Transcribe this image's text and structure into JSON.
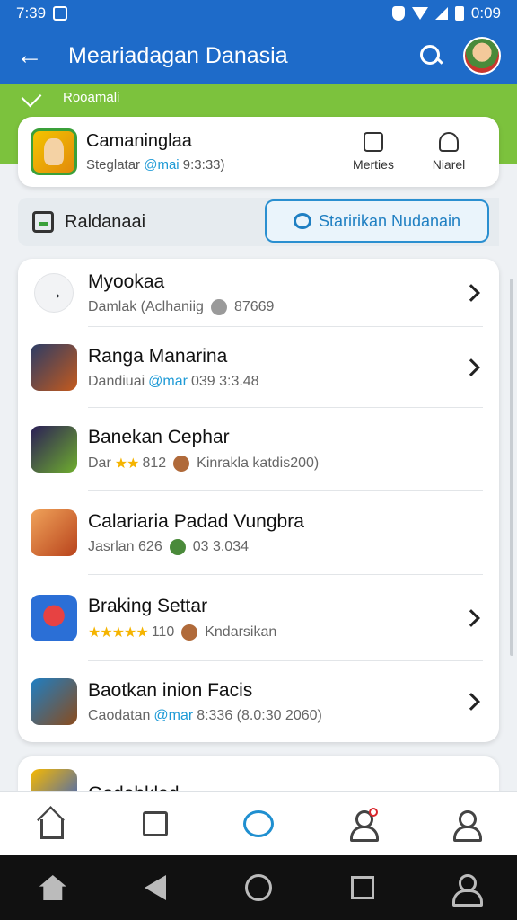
{
  "status_bar": {
    "time": "7:39",
    "battery": "0:09"
  },
  "app_bar": {
    "title": "Meariadagan Danasia",
    "back_icon": "back-arrow-icon",
    "search_icon": "search-icon"
  },
  "banner": {
    "label": "Rooamali"
  },
  "featured": {
    "title": "Camaninglaa",
    "sub_prefix": "Steglatar",
    "sub_handle": "@mai",
    "sub_value": "9:3:33)",
    "action1_label": "Merties",
    "action2_label": "Niarel"
  },
  "filter": {
    "label": "Raldanaai",
    "button_label": "Staririkan Nudanain"
  },
  "items": [
    {
      "title": "Myookaa",
      "sub_a": "Damlak (Aclhaniig",
      "sub_b": "87669"
    },
    {
      "title": "Ranga Manarina",
      "sub_a": "Dandiuai",
      "sub_handle": "@mar",
      "sub_b": "039 3:3.48"
    },
    {
      "title": "Banekan Cephar",
      "sub_a": "Dar",
      "stars": "★★",
      "sub_num": "812",
      "sub_b": "Kinrakla katdis200)"
    },
    {
      "title": "Calariaria Padad Vungbra",
      "sub_a": "Jasrlan 626",
      "sub_b": "03 3.034"
    },
    {
      "title": "Braking Settar",
      "stars": "★★★★★",
      "sub_num": "110",
      "sub_b": "Kndarsikan"
    },
    {
      "title": "Baotkan inion Facis",
      "sub_a": "Caodatan",
      "sub_handle": "@mar",
      "sub_b": "8:336 (8.0:30 2060)"
    }
  ],
  "peek_item": {
    "title": "Godohklad"
  },
  "bottom_nav": [
    "home-icon",
    "media-icon",
    "games-icon",
    "profile-icon",
    "account-icon"
  ],
  "colors": {
    "primary": "#1e6bc9",
    "banner_green": "#7cc23d",
    "accent_blue": "#1e9ad6",
    "notif_red": "#d9262c",
    "star": "#f5b400"
  }
}
